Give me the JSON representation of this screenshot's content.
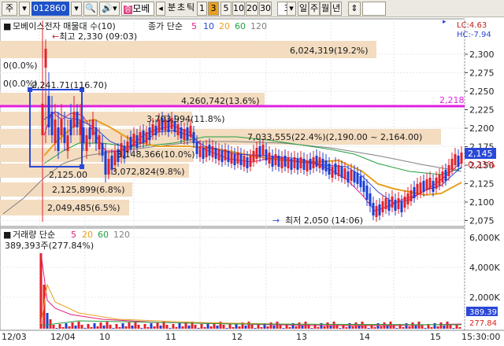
{
  "toolbar": {
    "type_label": "주",
    "code": "012860",
    "stock_name": "모베이스전자",
    "jeung_badge": "증",
    "stock_short": "모베",
    "period_buttons": [
      "분",
      "초",
      "틱",
      "1",
      "3",
      "5",
      "10",
      "20",
      "30"
    ],
    "period_active": "3",
    "interval_value": "3",
    "range_buttons": [
      "일",
      "주",
      "월",
      "년"
    ],
    "range_sep": "-"
  },
  "price_panel": {
    "legend_name": "모베이스전자",
    "legend_text": "모베이스전자 매물대 수(10)",
    "ma_legend_prefix": "종가 단순",
    "ma_periods": [
      "5",
      "10",
      "20",
      "60",
      "120"
    ],
    "lc_label": "LC:4.63",
    "hc_label": "HC:-7.94",
    "y_ticks": [
      "2,300",
      "2,275",
      "2,250",
      "2,225",
      "2,200",
      "2,175",
      "2,150",
      "2,125",
      "2,100",
      "2,075"
    ],
    "current_price": "2,145",
    "current_pct": "0.23%",
    "hline_value": "2,218",
    "high_annot": "최고 2,330 (09:03)",
    "low_annot": "최저 2,050 (14:06)",
    "box_top": "2,241.71(116.70)",
    "box_bottom": "2,125.00",
    "zero_labels": [
      "0(0.0%)",
      "0(0.0%)"
    ],
    "volume_profile_labels": [
      "6,024,319(19.2%)",
      "4,260,742(13.6%)",
      "3,703,994(11.8%)",
      "7,033,555(22.4%)(2,190.00 ~ 2,164.00)",
      "3,148,366(10.0%)",
      "3,072,824(9.8%)",
      "2,125,899(6.8%)",
      "2,049,485(6.5%)"
    ]
  },
  "volume_panel": {
    "legend_prefix": "거래량 단순",
    "ma_periods": [
      "5",
      "20",
      "60",
      "120"
    ],
    "last_value": "389,393주(277.84%)",
    "y_ticks": [
      "6,000K",
      "4,000K",
      "2,000K"
    ],
    "current_vol": "389.39",
    "current_pct": "277.84"
  },
  "x_axis": {
    "labels": [
      "12/03",
      "12/04",
      "10",
      "11",
      "12",
      "13",
      "14",
      "15"
    ],
    "time_label": "15:30:00"
  },
  "colors": {
    "up": "#e4202a",
    "down": "#1a3ed6",
    "ma5": "#e0207a",
    "ma10": "#2a48d8",
    "ma20": "#e8a020",
    "ma60": "#22a040",
    "ma120": "#808080",
    "hline": "#e020e0",
    "profile": "#f3dcc0"
  },
  "chart_data": {
    "type": "candlestick",
    "title": "모베이스전자",
    "x": [
      "09:03",
      "10",
      "11",
      "12",
      "13",
      "14",
      "15"
    ],
    "high": 2330,
    "low": 2050,
    "last": 2145,
    "hline": 2218,
    "ylim": [
      2060,
      2320
    ],
    "volume_ylim": [
      0,
      6500000
    ],
    "volume_last": 389393
  }
}
